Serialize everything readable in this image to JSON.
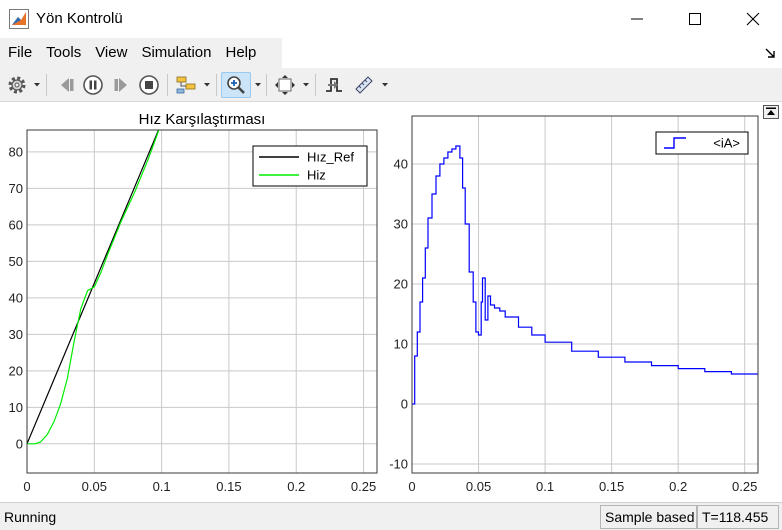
{
  "window": {
    "title": "Yön Kontrolü",
    "app_icon": "matlab-icon",
    "controls": [
      "minimize-icon",
      "maximize-icon",
      "close-icon"
    ]
  },
  "menu": {
    "items": [
      "File",
      "Tools",
      "View",
      "Simulation",
      "Help"
    ]
  },
  "toolbar": {
    "buttons": [
      {
        "name": "settings-button",
        "icon": "gear-icon"
      },
      {
        "name": "step-back-button",
        "icon": "step-back-icon"
      },
      {
        "name": "pause-button",
        "icon": "pause-icon"
      },
      {
        "name": "step-forward-button",
        "icon": "step-forward-icon"
      },
      {
        "name": "stop-button",
        "icon": "stop-icon"
      },
      {
        "name": "highlight-signal-button",
        "icon": "signal-tree-icon"
      },
      {
        "name": "zoom-button",
        "icon": "zoom-in-icon"
      },
      {
        "name": "fit-to-view-button",
        "icon": "fit-view-icon"
      },
      {
        "name": "triggers-button",
        "icon": "trigger-icon"
      },
      {
        "name": "measurements-button",
        "icon": "ruler-icon"
      }
    ]
  },
  "chart_data": [
    {
      "type": "line",
      "title": "Hız Karşılaştırması",
      "xlim": [
        0,
        0.26
      ],
      "ylim": [
        -8,
        86
      ],
      "xticks": [
        "0",
        "0.05",
        "0.1",
        "0.15",
        "0.2",
        "0.25"
      ],
      "yticks": [
        "0",
        "10",
        "20",
        "30",
        "40",
        "50",
        "60",
        "70",
        "80"
      ],
      "grid": true,
      "legend_position": "top-right",
      "series": [
        {
          "name": "Hız_Ref",
          "color": "#000000",
          "x": [
            0,
            0.1
          ],
          "y": [
            0,
            88
          ]
        },
        {
          "name": "Hiz",
          "color": "#00ee00",
          "x": [
            0,
            0.006,
            0.01,
            0.015,
            0.02,
            0.025,
            0.03,
            0.035,
            0.04,
            0.045,
            0.05,
            0.055,
            0.06,
            0.07,
            0.08,
            0.09,
            0.1
          ],
          "y": [
            0,
            0,
            0.5,
            2.5,
            6,
            11,
            18,
            28,
            37,
            42,
            43,
            47,
            52,
            61,
            69,
            78,
            88
          ]
        }
      ]
    },
    {
      "type": "line",
      "title": "",
      "xlim": [
        0,
        0.26
      ],
      "ylim": [
        -11.5,
        48
      ],
      "xticks": [
        "0",
        "0.05",
        "0.1",
        "0.15",
        "0.2",
        "0.25"
      ],
      "yticks": [
        "-10",
        "0",
        "10",
        "20",
        "30",
        "40"
      ],
      "grid": true,
      "legend_position": "top-right",
      "series": [
        {
          "name": "<iA>",
          "color": "#0000ff",
          "x": [
            0,
            0.002,
            0.004,
            0.006,
            0.008,
            0.01,
            0.012,
            0.015,
            0.018,
            0.021,
            0.024,
            0.027,
            0.03,
            0.033,
            0.036,
            0.038,
            0.04,
            0.043,
            0.046,
            0.048,
            0.05,
            0.052,
            0.053,
            0.055,
            0.057,
            0.059,
            0.062,
            0.066,
            0.07,
            0.08,
            0.09,
            0.1,
            0.12,
            0.14,
            0.16,
            0.18,
            0.2,
            0.22,
            0.24,
            0.26
          ],
          "y": [
            0,
            8,
            12,
            17,
            21,
            26,
            31,
            35,
            38,
            40,
            41,
            42,
            42.5,
            43,
            41,
            36,
            30,
            22,
            17,
            12,
            11.5,
            17,
            21,
            14,
            18,
            16.5,
            16,
            15.5,
            14.5,
            12.8,
            11.5,
            10.3,
            8.8,
            7.8,
            7.0,
            6.4,
            5.9,
            5.4,
            5.0,
            4.7
          ]
        }
      ]
    }
  ],
  "status": {
    "state": "Running",
    "sample_mode": "Sample based",
    "time": "T=118.455"
  }
}
